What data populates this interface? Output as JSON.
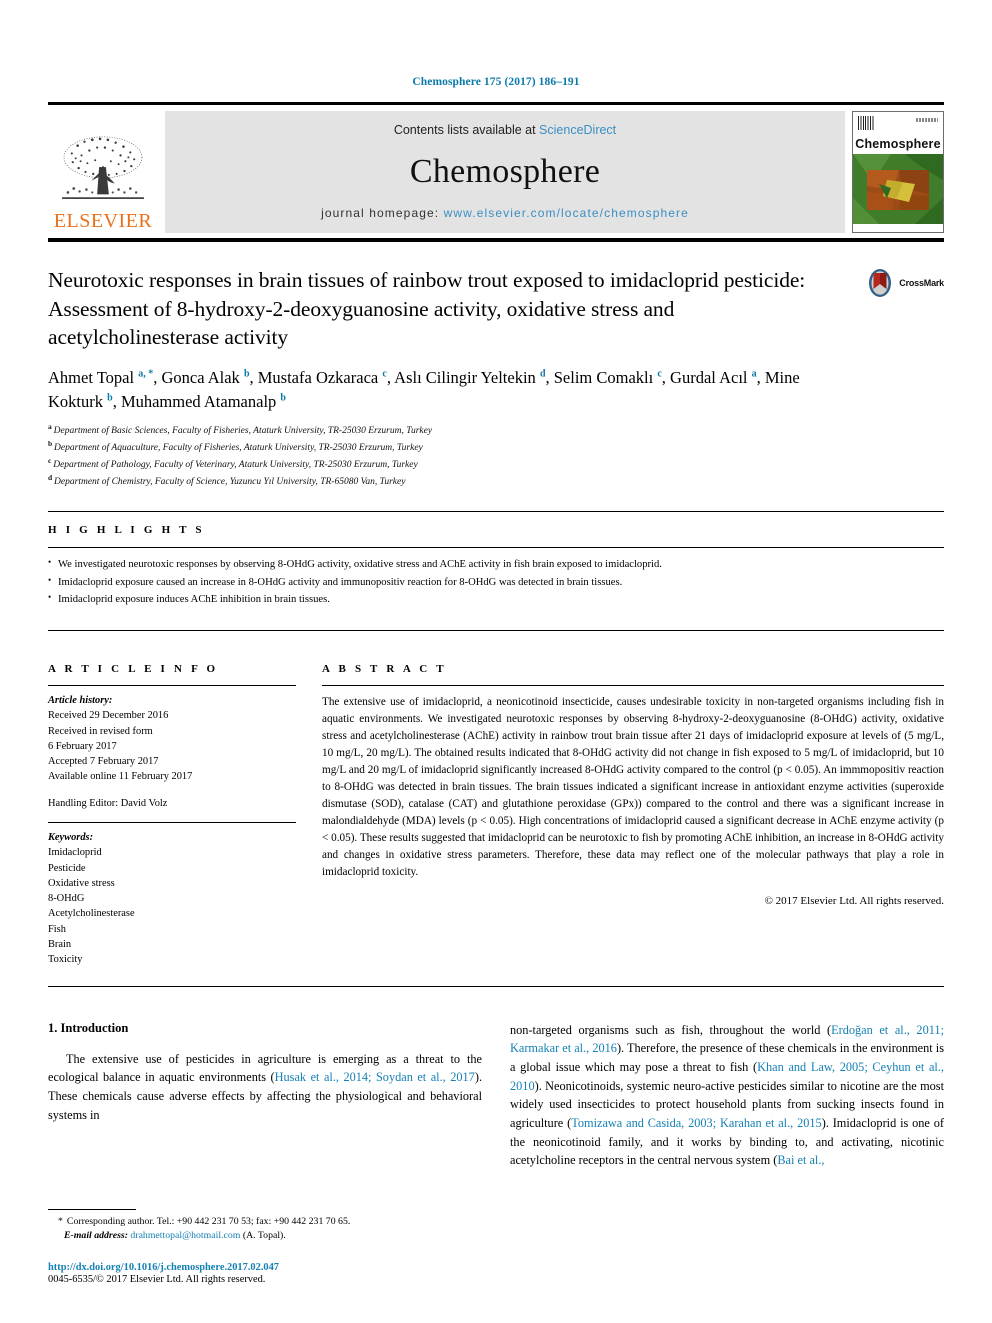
{
  "running_head": "Chemosphere 175 (2017) 186–191",
  "masthead": {
    "publisher_name": "ELSEVIER",
    "publisher_logo_icon": "elsevier-tree-icon",
    "contents_prefix": "Contents lists available at ",
    "contents_link": "ScienceDirect",
    "journal_name": "Chemosphere",
    "homepage_prefix": "journal homepage: ",
    "homepage_url": "www.elsevier.com/locate/chemosphere",
    "cover_title": "Chemosphere"
  },
  "article": {
    "title": "Neurotoxic responses in brain tissues of rainbow trout exposed to imidacloprid pesticide: Assessment of 8-hydroxy-2-deoxyguanosine activity, oxidative stress and acetylcholinesterase activity",
    "crossmark_label": "CrossMark",
    "authors": [
      {
        "name": "Ahmet Topal",
        "marks": "a, *",
        "sep": ", "
      },
      {
        "name": "Gonca Alak",
        "marks": "b",
        "sep": ", "
      },
      {
        "name": "Mustafa Ozkaraca",
        "marks": "c",
        "sep": ", "
      },
      {
        "name": "Aslı Cilingir Yeltekin",
        "marks": "d",
        "sep": ", "
      },
      {
        "name": "Selim Comaklı",
        "marks": "c",
        "sep": ", "
      },
      {
        "name": "Gurdal Acıl",
        "marks": "a",
        "sep": ", "
      },
      {
        "name": "Mine Kokturk",
        "marks": "b",
        "sep": ", "
      },
      {
        "name": "Muhammed Atamanalp",
        "marks": "b",
        "sep": ""
      }
    ],
    "affiliations": [
      {
        "mark": "a",
        "text": "Department of Basic Sciences, Faculty of Fisheries, Ataturk University, TR-25030 Erzurum, Turkey"
      },
      {
        "mark": "b",
        "text": "Department of Aquaculture, Faculty of Fisheries, Ataturk University, TR-25030 Erzurum, Turkey"
      },
      {
        "mark": "c",
        "text": "Department of Pathology, Faculty of Veterinary, Ataturk University, TR-25030 Erzurum, Turkey"
      },
      {
        "mark": "d",
        "text": "Department of Chemistry, Faculty of Science, Yuzuncu Yıl University, TR-65080 Van, Turkey"
      }
    ]
  },
  "highlights": {
    "label": "H I G H L I G H T S",
    "items": [
      "We investigated neurotoxic responses by observing 8-OHdG activity, oxidative stress and AChE activity in fish brain exposed to imidacloprid.",
      "Imidacloprid exposure caused an increase in 8-OHdG activity and immunopositiv reaction for 8-OHdG was detected in brain tissues.",
      "Imidacloprid exposure induces AChE inhibition in brain tissues."
    ]
  },
  "article_info": {
    "label": "A R T I C L E  I N F O",
    "history_heading": "Article history:",
    "history_lines": [
      "Received 29 December 2016",
      "Received in revised form",
      "6 February 2017",
      "Accepted 7 February 2017",
      "Available online 11 February 2017"
    ],
    "handling_editor": "Handling Editor: David Volz",
    "keywords_heading": "Keywords:",
    "keywords": [
      "Imidacloprid",
      "Pesticide",
      "Oxidative stress",
      "8-OHdG",
      "Acetylcholinesterase",
      "Fish",
      "Brain",
      "Toxicity"
    ]
  },
  "abstract": {
    "label": "A B S T R A C T",
    "text": "The extensive use of imidacloprid, a neonicotinoid insecticide, causes undesirable toxicity in non-targeted organisms including fish in aquatic environments. We investigated neurotoxic responses by observing 8-hydroxy-2-deoxyguanosine (8-OHdG) activity, oxidative stress and acetylcholinesterase (AChE) activity in rainbow trout brain tissue after 21 days of imidacloprid exposure at levels of (5 mg/L, 10 mg/L, 20 mg/L). The obtained results indicated that 8-OHdG activity did not change in fish exposed to 5 mg/L of imidacloprid, but 10 mg/L and 20 mg/L of imidacloprid significantly increased 8-OHdG activity compared to the control (p < 0.05). An immmopositiv reaction to 8-OHdG was detected in brain tissues. The brain tissues indicated a significant increase in antioxidant enzyme activities (superoxide dismutase (SOD), catalase (CAT) and glutathione peroxidase (GPx)) compared to the control and there was a significant increase in malondialdehyde (MDA) levels (p < 0.05). High concentrations of imidacloprid caused a significant decrease in AChE enzyme activity (p < 0.05). These results suggested that imidacloprid can be neurotoxic to fish by promoting AChE inhibition, an increase in 8-OHdG activity and changes in oxidative stress parameters. Therefore, these data may reflect one of the molecular pathways that play a role in imidacloprid toxicity.",
    "copyright": "© 2017 Elsevier Ltd. All rights reserved."
  },
  "introduction": {
    "heading": "1. Introduction",
    "left_paragraph_parts": [
      {
        "t": "The extensive use of pesticides in agriculture is emerging as a threat to the ecological balance in aquatic environments (",
        "ref": false
      },
      {
        "t": "Husak et al., 2014; Soydan et al., 2017",
        "ref": true
      },
      {
        "t": "). These chemicals cause adverse effects by affecting the physiological and behavioral systems in",
        "ref": false
      }
    ],
    "right_paragraph_parts": [
      {
        "t": "non-targeted organisms such as fish, throughout the world (",
        "ref": false
      },
      {
        "t": "Erdoğan et al., 2011; Karmakar et al., 2016",
        "ref": true
      },
      {
        "t": "). Therefore, the presence of these chemicals in the environment is a global issue which may pose a threat to fish (",
        "ref": false
      },
      {
        "t": "Khan and Law, 2005; Ceyhun et al., 2010",
        "ref": true
      },
      {
        "t": "). Neonicotinoids, systemic neuro-active pesticides similar to nicotine are the most widely used insecticides to protect household plants from sucking insects found in agriculture (",
        "ref": false
      },
      {
        "t": "Tomizawa and Casida, 2003; Karahan et al., 2015",
        "ref": true
      },
      {
        "t": "). Imidacloprid is one of the neonicotinoid family, and it works by binding to, and activating, nicotinic acetylcholine receptors in the central nervous system (",
        "ref": false
      },
      {
        "t": "Bai et al.,",
        "ref": true
      }
    ]
  },
  "footnote": {
    "star": "*",
    "corresponding": "Corresponding author. Tel.: +90 442 231 70 53; fax: +90 442 231 70 65.",
    "email_label": "E-mail address:",
    "email": "drahmettopal@hotmail.com",
    "email_suffix": " (A. Topal).",
    "doi": "http://dx.doi.org/10.1016/j.chemosphere.2017.02.047",
    "issn": "0045-6535/© 2017 Elsevier Ltd. All rights reserved."
  },
  "colors": {
    "link_blue": "#1580b4",
    "header_blue": "#0b7aa8",
    "elsevier_orange": "#E9711C",
    "masthead_gray": "#e3e3e3"
  }
}
